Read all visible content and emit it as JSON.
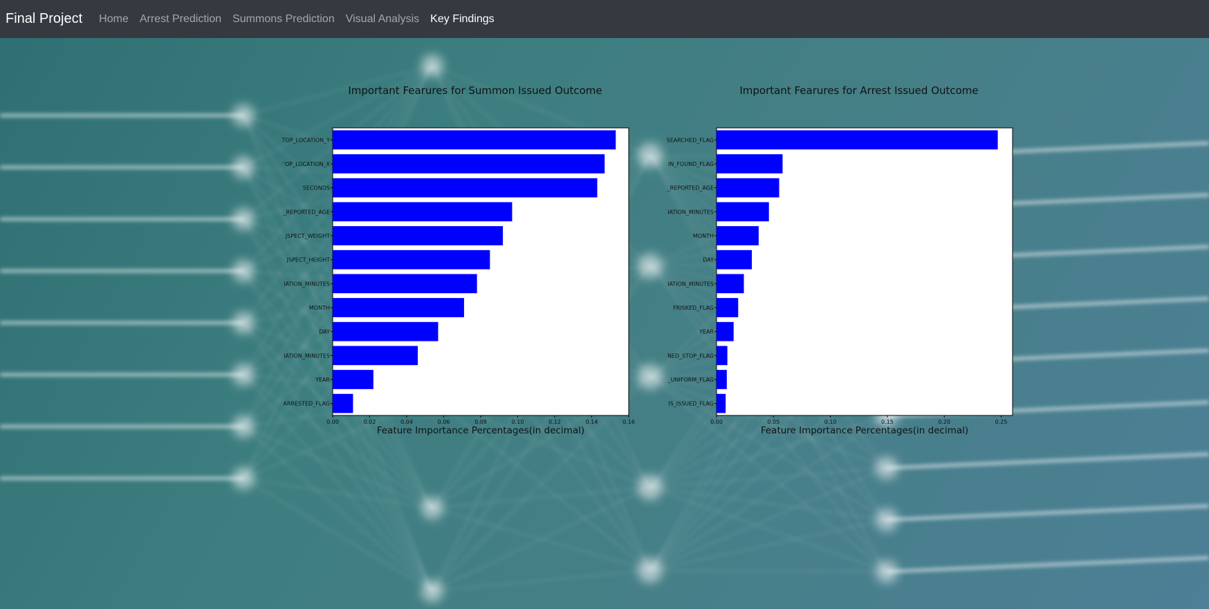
{
  "navbar": {
    "brand": "Final Project",
    "links": [
      {
        "label": "Home",
        "active": false
      },
      {
        "label": "Arrest Prediction",
        "active": false
      },
      {
        "label": "Summons Prediction",
        "active": false
      },
      {
        "label": "Visual Analysis",
        "active": false
      },
      {
        "label": "Key Findings",
        "active": true
      }
    ]
  },
  "colors": {
    "bar": "#0000ff",
    "navbar_bg": "#343a40"
  },
  "chart_data": [
    {
      "type": "bar",
      "orientation": "horizontal",
      "title": "Important Fearures for Summon Issued Outcome",
      "xlabel": "Feature Importance Percentages(in decimal)",
      "ylabel": "",
      "xlim": [
        0,
        0.16
      ],
      "xticks": [
        "0.00",
        "0.02",
        "0.04",
        "0.06",
        "0.08",
        "0.10",
        "0.12",
        "0.14",
        "0.16"
      ],
      "categories": [
        "TOP_LOCATION_Y",
        "'OP_LOCATION_X",
        "SECONDS",
        "_REPORTED_AGE",
        "JSPECT_WEIGHT",
        "JSPECT_HEIGHT",
        "IATION_MINUTES",
        "MONTH",
        "DAY",
        "IATION_MINUTES",
        "YEAR",
        "ARRESTED_FLAG"
      ],
      "values": [
        0.153,
        0.147,
        0.143,
        0.097,
        0.092,
        0.085,
        0.078,
        0.071,
        0.057,
        0.046,
        0.022,
        0.011
      ]
    },
    {
      "type": "bar",
      "orientation": "horizontal",
      "title": "Important Fearures for Arrest Issued Outcome",
      "xlabel": "Feature Importance Percentages(in decimal)",
      "ylabel": "",
      "xlim": [
        0,
        0.26
      ],
      "xticks": [
        "0.00",
        "0.05",
        "0.10",
        "0.15",
        "0.20",
        "0.25"
      ],
      "categories": [
        "SEARCHED_FLAG",
        "IN_FOUND_FLAG",
        "_REPORTED_AGE",
        "IATION_MINUTES",
        "MONTH",
        "DAY",
        "IATION_MINUTES",
        "FRISKED_FLAG",
        "YEAR",
        "NED_STOP_FLAG",
        "_UNIFORM_FLAG",
        "IS_ISSUED_FLAG"
      ],
      "values": [
        0.247,
        0.058,
        0.055,
        0.046,
        0.037,
        0.031,
        0.024,
        0.019,
        0.015,
        0.0095,
        0.009,
        0.008
      ]
    }
  ]
}
